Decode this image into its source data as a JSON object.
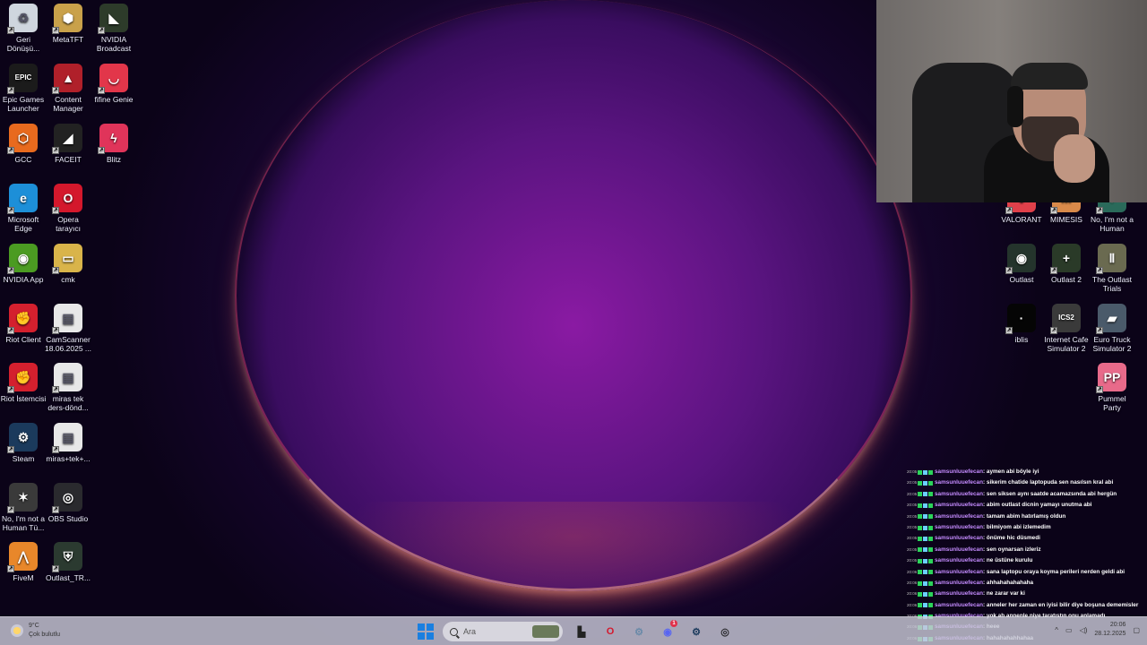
{
  "desktop": {
    "left_icons": [
      {
        "label": "Geri Dönüşü...",
        "icon": "recycle-bin-icon",
        "color": "#cfd6de",
        "glyph": "♻"
      },
      {
        "label": "MetaTFT",
        "icon": "metatft-icon",
        "color": "#c9a14a",
        "glyph": "⬢"
      },
      {
        "label": "NVIDIA Broadcast",
        "icon": "nvidia-broadcast-icon",
        "color": "#2d3b2a",
        "glyph": "◣"
      },
      {
        "label": "Epic Games Launcher",
        "icon": "epic-games-icon",
        "color": "#1b1b1b",
        "glyph": "EPIC"
      },
      {
        "label": "Content Manager",
        "icon": "content-manager-icon",
        "color": "#b0202a",
        "glyph": "▲"
      },
      {
        "label": "fifine Genie",
        "icon": "fifine-genie-icon",
        "color": "#e2364a",
        "glyph": "◡"
      },
      {
        "label": "GCC",
        "icon": "gcc-icon",
        "color": "#e86a1e",
        "glyph": "⬡"
      },
      {
        "label": "FACEIT",
        "icon": "faceit-icon",
        "color": "#222222",
        "glyph": "◢"
      },
      {
        "label": "Blitz",
        "icon": "blitz-icon",
        "color": "#e0345a",
        "glyph": "ϟ"
      },
      {
        "label": "Microsoft Edge",
        "icon": "edge-icon",
        "color": "#1d8fd8",
        "glyph": "e"
      },
      {
        "label": "Opera tarayıcı",
        "icon": "opera-icon",
        "color": "#d4182c",
        "glyph": "O"
      },
      {
        "label": "NVIDIA App",
        "icon": "nvidia-app-icon",
        "color": "#4b9b22",
        "glyph": "◉"
      },
      {
        "label": "cmk",
        "icon": "folder-icon",
        "color": "#d9b44a",
        "glyph": "▭"
      },
      {
        "label": "Riot Client",
        "icon": "riot-client-icon",
        "color": "#d4202e",
        "glyph": "✊"
      },
      {
        "label": "CamScanner 18.06.2025 ...",
        "icon": "document-icon",
        "color": "#e8e8e8",
        "glyph": "▤"
      },
      {
        "label": "Riot İstemcisi",
        "icon": "riot-istemcisi-icon",
        "color": "#d4202e",
        "glyph": "✊"
      },
      {
        "label": "miras tek ders-dönd...",
        "icon": "document-icon",
        "color": "#e8e8e8",
        "glyph": "▤"
      },
      {
        "label": "Steam",
        "icon": "steam-icon",
        "color": "#1b3a5c",
        "glyph": "⚙"
      },
      {
        "label": "miras+tek+...",
        "icon": "document-icon",
        "color": "#e8e8e8",
        "glyph": "▤"
      },
      {
        "label": "No, I'm not a Human Tü...",
        "icon": "no-im-not-a-human-icon",
        "color": "#3a3a3a",
        "glyph": "✶"
      },
      {
        "label": "OBS Studio",
        "icon": "obs-studio-icon",
        "color": "#2a2a2e",
        "glyph": "◎"
      },
      {
        "label": "FiveM",
        "icon": "fivem-icon",
        "color": "#e8872a",
        "glyph": "⋀"
      },
      {
        "label": "Outlast_TR...",
        "icon": "outlast-tr-icon",
        "color": "#2b3a30",
        "glyph": "⛨"
      }
    ],
    "right_icons": [
      {
        "label": "VALORANT",
        "icon": "valorant-icon",
        "color": "#e0404a",
        "glyph": "V"
      },
      {
        "label": "MIMESIS",
        "icon": "mimesis-icon",
        "color": "#d98a4a",
        "glyph": "M"
      },
      {
        "label": "No, I'm not a Human",
        "icon": "no-im-not-a-human-game-icon",
        "color": "#2a6a5a",
        "glyph": "✶"
      },
      {
        "label": "Outlast",
        "icon": "outlast-icon",
        "color": "#24342c",
        "glyph": "◉"
      },
      {
        "label": "Outlast 2",
        "icon": "outlast-2-icon",
        "color": "#2a3a28",
        "glyph": "+"
      },
      {
        "label": "The Outlast Trials",
        "icon": "outlast-trials-icon",
        "color": "#6a6a50",
        "glyph": "Ⅱ"
      },
      {
        "label": "iblis",
        "icon": "iblis-icon",
        "color": "#050505",
        "glyph": "·"
      },
      {
        "label": "Internet Cafe Simulator 2",
        "icon": "internet-cafe-sim-2-icon",
        "color": "#3a3a3a",
        "glyph": "ICS2"
      },
      {
        "label": "Euro Truck Simulator 2",
        "icon": "euro-truck-sim-2-icon",
        "color": "#4a5a6a",
        "glyph": "▰"
      },
      {
        "label": "Pummel Party",
        "icon": "pummel-party-icon",
        "color": "#e86a8a",
        "glyph": "PP"
      }
    ]
  },
  "chat": {
    "messages": [
      {
        "ts": "20:05",
        "user": "samsunluuefecan",
        "msg": ": aymen abi böyle iyi"
      },
      {
        "ts": "20:05",
        "user": "samsunluuefecan",
        "msg": ": sikerim chatide laptopuda sen nasılsın kral abi"
      },
      {
        "ts": "20:05",
        "user": "samsunluuefecan",
        "msg": ": sen siksen aynı saatde acamazsında abi hergün"
      },
      {
        "ts": "20:05",
        "user": "samsunluuefecan",
        "msg": ": abim outlast dicnin yamayı unutma abi"
      },
      {
        "ts": "20:05",
        "user": "samsunluuefecan",
        "msg": ": tamam abim hatırlamış oldun"
      },
      {
        "ts": "20:05",
        "user": "samsunluuefecan",
        "msg": ": bilmiyom abi izlemedim"
      },
      {
        "ts": "20:05",
        "user": "samsunluuefecan",
        "msg": ": önüme hic düsmedi"
      },
      {
        "ts": "20:05",
        "user": "samsunluuefecan",
        "msg": ": sen oynarsan izleriz"
      },
      {
        "ts": "20:05",
        "user": "samsunluuefecan",
        "msg": ": ne üstüne kurulu"
      },
      {
        "ts": "20:06",
        "user": "samsunluuefecan",
        "msg": ": sana laptopu oraya koyma perileri nerden geldi abi"
      },
      {
        "ts": "20:06",
        "user": "samsunluuefecan",
        "msg": ": ahhahahahahaha"
      },
      {
        "ts": "20:06",
        "user": "samsunluuefecan",
        "msg": ": ne zarar var ki"
      },
      {
        "ts": "20:06",
        "user": "samsunluuefecan",
        "msg": ": anneler her zaman en iyisi bilir diye boşuna dememisler"
      },
      {
        "ts": "20:06",
        "user": "samsunluuefecan",
        "msg": ": yok ab annenle niye taratıstın onu anlamadı"
      },
      {
        "ts": "20:06",
        "user": "samsunluuefecan",
        "msg": ": heee"
      },
      {
        "ts": "20:06",
        "user": "samsunluuefecan",
        "msg": ": hahahahahhahaa"
      }
    ]
  },
  "taskbar": {
    "weather_temp": "9°C",
    "weather_desc": "Çok bulutlu",
    "search_placeholder": "Ara",
    "clock_time": "20:06",
    "clock_date": "28.12.2025",
    "discord_badge": "1"
  }
}
